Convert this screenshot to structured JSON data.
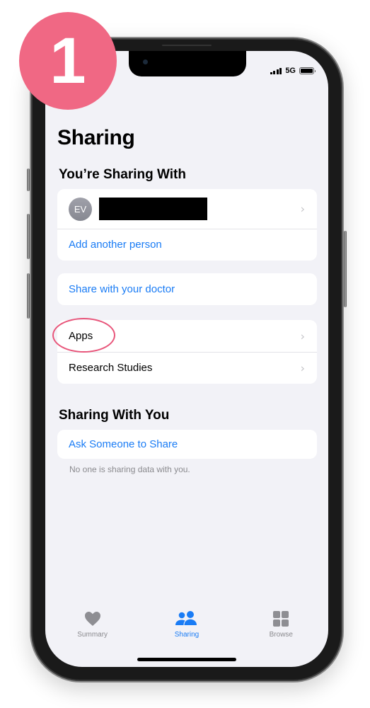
{
  "step_badge": "1",
  "status_bar": {
    "network": "5G"
  },
  "page": {
    "title": "Sharing",
    "sections": {
      "sharing_with": {
        "title": "You’re Sharing With",
        "person": {
          "initials": "EV",
          "name_redacted": true
        },
        "add_person": "Add another person"
      },
      "doctor": {
        "label": "Share with your doctor"
      },
      "other": {
        "items": [
          {
            "label": "Apps",
            "highlighted": true
          },
          {
            "label": "Research Studies"
          }
        ]
      },
      "sharing_with_you": {
        "title": "Sharing With You",
        "ask": "Ask Someone to Share",
        "footnote": "No one is sharing data with you."
      }
    }
  },
  "tabbar": {
    "tabs": [
      {
        "label": "Summary",
        "icon": "heart-icon",
        "active": false
      },
      {
        "label": "Sharing",
        "icon": "people-icon",
        "active": true
      },
      {
        "label": "Browse",
        "icon": "grid-icon",
        "active": false
      }
    ]
  },
  "colors": {
    "accent": "#1a7cf5",
    "badge": "#f06884",
    "highlight": "#e8557a"
  }
}
